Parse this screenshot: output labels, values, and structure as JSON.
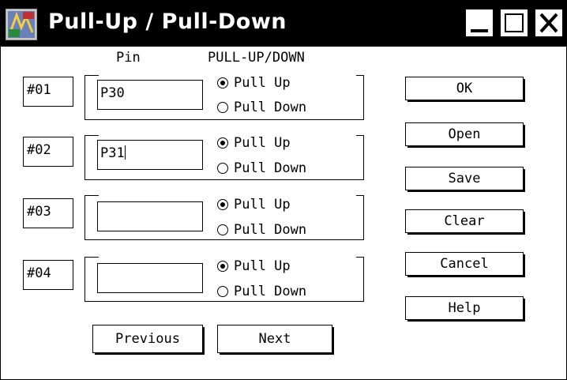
{
  "window": {
    "title": "Pull-Up / Pull-Down"
  },
  "columns": {
    "pin": "Pin",
    "mode": "PULL-UP/DOWN"
  },
  "rows": [
    {
      "label": "#01",
      "pin": "P30",
      "selected": "Pull Up"
    },
    {
      "label": "#02",
      "pin": "P31",
      "selected": "Pull Up"
    },
    {
      "label": "#03",
      "pin": "",
      "selected": "Pull Up"
    },
    {
      "label": "#04",
      "pin": "",
      "selected": "Pull Up"
    }
  ],
  "options": {
    "pull_up": "Pull Up",
    "pull_down": "Pull Down"
  },
  "buttons": {
    "ok": "OK",
    "open": "Open",
    "save": "Save",
    "clear": "Clear",
    "cancel": "Cancel",
    "help": "Help",
    "previous": "Previous",
    "next": "Next"
  },
  "icons": {
    "app": "app-icon",
    "minimize": "minimize-icon",
    "maximize": "maximize-icon",
    "close": "close-icon"
  }
}
